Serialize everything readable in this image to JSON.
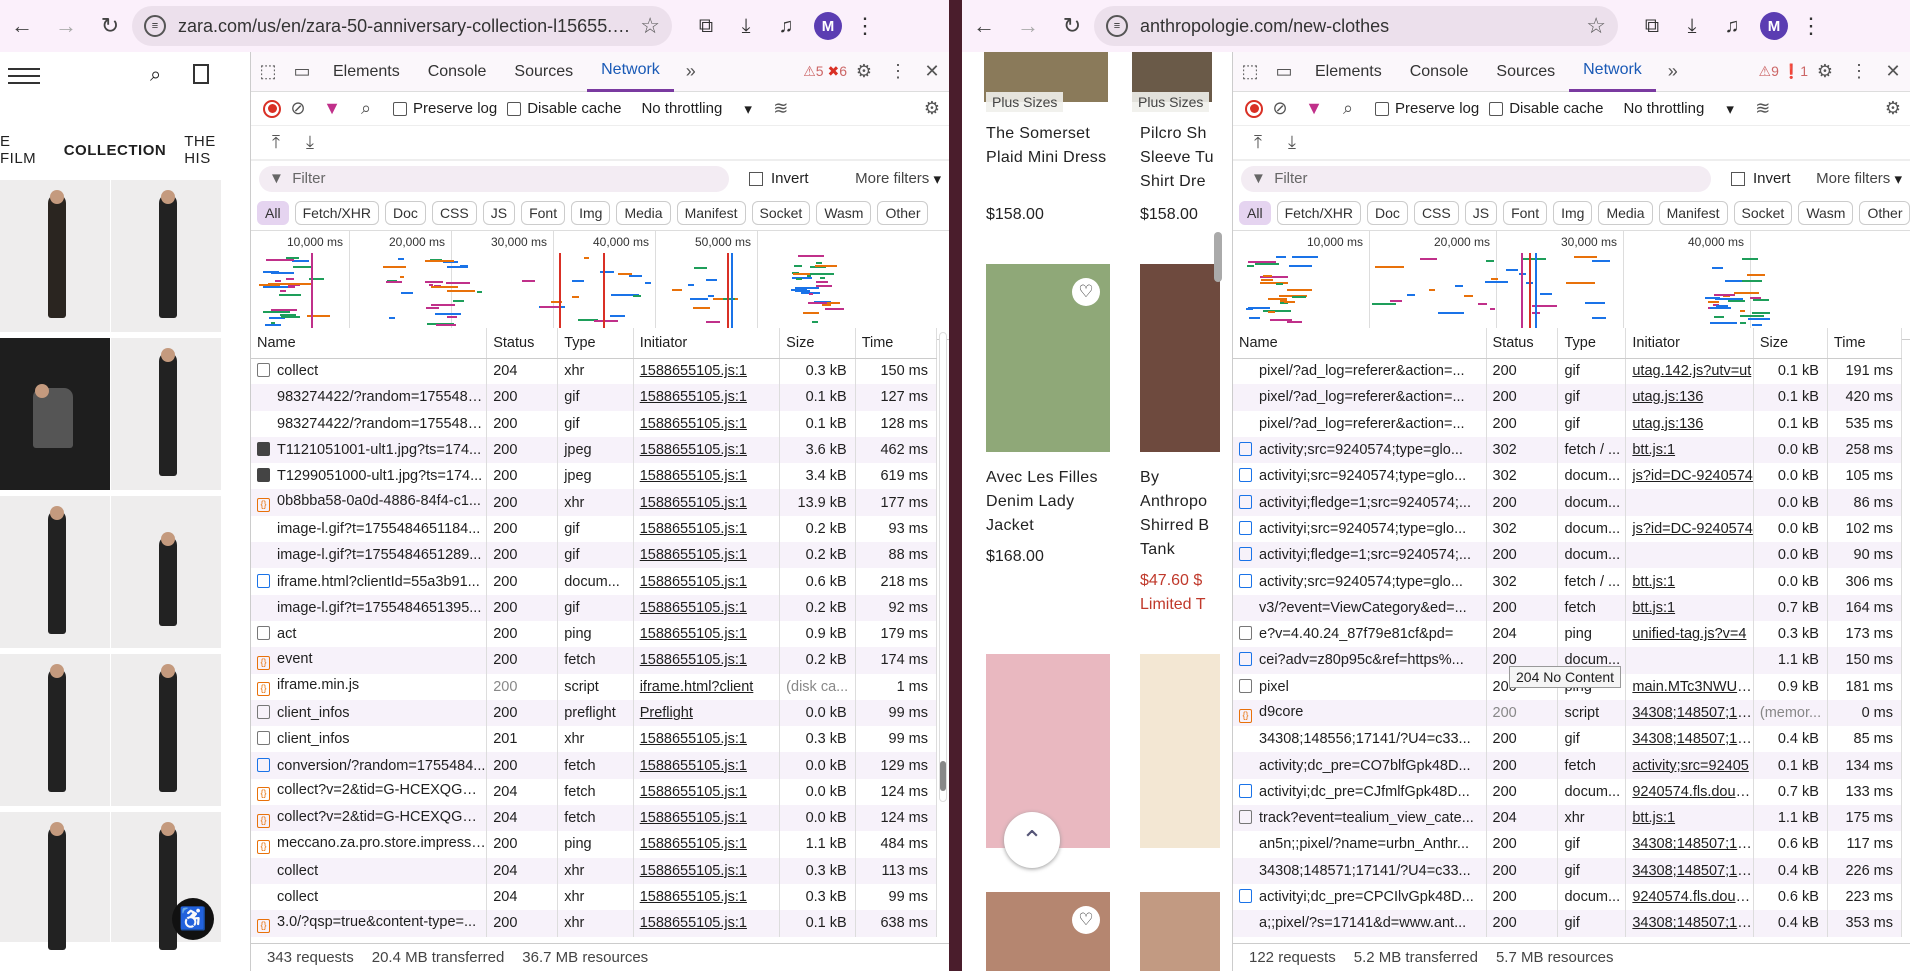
{
  "left": {
    "url": "zara.com/us/en/zara-50-anniversary-collection-l15655.h...",
    "avatar": "M",
    "site_tabs": [
      "E FILM",
      "COLLECTION",
      "THE HIS"
    ],
    "devtools": {
      "tabs": [
        "Elements",
        "Console",
        "Sources",
        "Network"
      ],
      "warnings": "5",
      "errors": "6",
      "preserve_log": "Preserve log",
      "disable_cache": "Disable cache",
      "throttling": "No throttling",
      "filter_placeholder": "Filter",
      "invert": "Invert",
      "more_filters": "More filters",
      "chips": [
        "All",
        "Fetch/XHR",
        "Doc",
        "CSS",
        "JS",
        "Font",
        "Img",
        "Media",
        "Manifest",
        "Socket",
        "Wasm",
        "Other"
      ],
      "ticks": [
        "10,000 ms",
        "20,000 ms",
        "30,000 ms",
        "40,000 ms",
        "50,000 ms"
      ],
      "columns": [
        "Name",
        "Status",
        "Type",
        "Initiator",
        "Size",
        "Time"
      ],
      "rows": [
        {
          "icon": "none",
          "name": "collect",
          "status": "204",
          "type": "xhr",
          "initiator": "1588655105.js:1",
          "size": "0.3 kB",
          "time": "150 ms"
        },
        {
          "icon": "blank",
          "name": "983274422/?random=1755484...",
          "status": "200",
          "type": "gif",
          "initiator": "1588655105.js:1",
          "size": "0.1 kB",
          "time": "127 ms"
        },
        {
          "icon": "blank",
          "name": "983274422/?random=1755484...",
          "status": "200",
          "type": "gif",
          "initiator": "1588655105.js:1",
          "size": "0.1 kB",
          "time": "128 ms"
        },
        {
          "icon": "img",
          "name": "T1121051001-ult1.jpg?ts=174...",
          "status": "200",
          "type": "jpeg",
          "initiator": "1588655105.js:1",
          "size": "3.6 kB",
          "time": "462 ms"
        },
        {
          "icon": "img",
          "name": "T1299051000-ult1.jpg?ts=174...",
          "status": "200",
          "type": "jpeg",
          "initiator": "1588655105.js:1",
          "size": "3.4 kB",
          "time": "619 ms"
        },
        {
          "icon": "script",
          "name": "0b8bba58-0a0d-4886-84f4-c1...",
          "status": "200",
          "type": "xhr",
          "initiator": "1588655105.js:1",
          "size": "13.9 kB",
          "time": "177 ms"
        },
        {
          "icon": "blank",
          "name": "image-l.gif?t=1755484651184...",
          "status": "200",
          "type": "gif",
          "initiator": "1588655105.js:1",
          "size": "0.2 kB",
          "time": "93 ms"
        },
        {
          "icon": "blank",
          "name": "image-l.gif?t=1755484651289...",
          "status": "200",
          "type": "gif",
          "initiator": "1588655105.js:1",
          "size": "0.2 kB",
          "time": "88 ms"
        },
        {
          "icon": "doc",
          "name": "iframe.html?clientId=55a3b91...",
          "status": "200",
          "type": "docum...",
          "initiator": "1588655105.js:1",
          "size": "0.6 kB",
          "time": "218 ms"
        },
        {
          "icon": "blank",
          "name": "image-l.gif?t=1755484651395...",
          "status": "200",
          "type": "gif",
          "initiator": "1588655105.js:1",
          "size": "0.2 kB",
          "time": "92 ms"
        },
        {
          "icon": "none",
          "name": "act",
          "status": "200",
          "type": "ping",
          "initiator": "1588655105.js:1",
          "size": "0.9 kB",
          "time": "179 ms"
        },
        {
          "icon": "script",
          "name": "event",
          "status": "200",
          "type": "fetch",
          "initiator": "1588655105.js:1",
          "size": "0.2 kB",
          "time": "174 ms"
        },
        {
          "icon": "script",
          "name": "iframe.min.js",
          "status": "200",
          "type": "script",
          "initiator": "iframe.html?client",
          "size": "(disk ca...",
          "time": "1 ms"
        },
        {
          "icon": "none",
          "name": "client_infos",
          "status": "200",
          "type": "preflight",
          "initiator": "Preflight",
          "size": "0.0 kB",
          "time": "99 ms"
        },
        {
          "icon": "none",
          "name": "client_infos",
          "status": "201",
          "type": "xhr",
          "initiator": "1588655105.js:1",
          "size": "0.3 kB",
          "time": "99 ms"
        },
        {
          "icon": "doc",
          "name": "conversion/?random=1755484...",
          "status": "200",
          "type": "fetch",
          "initiator": "1588655105.js:1",
          "size": "0.0 kB",
          "time": "129 ms"
        },
        {
          "icon": "script",
          "name": "collect?v=2&tid=G-HCEXQGE0...",
          "status": "204",
          "type": "fetch",
          "initiator": "1588655105.js:1",
          "size": "0.0 kB",
          "time": "124 ms"
        },
        {
          "icon": "script",
          "name": "collect?v=2&tid=G-HCEXQGE0...",
          "status": "204",
          "type": "fetch",
          "initiator": "1588655105.js:1",
          "size": "0.0 kB",
          "time": "124 ms"
        },
        {
          "icon": "script",
          "name": "meccano.za.pro.store.impressi...",
          "status": "200",
          "type": "ping",
          "initiator": "1588655105.js:1",
          "size": "1.1 kB",
          "time": "484 ms"
        },
        {
          "icon": "blank",
          "name": "collect",
          "status": "204",
          "type": "xhr",
          "initiator": "1588655105.js:1",
          "size": "0.3 kB",
          "time": "113 ms"
        },
        {
          "icon": "blank",
          "name": "collect",
          "status": "204",
          "type": "xhr",
          "initiator": "1588655105.js:1",
          "size": "0.3 kB",
          "time": "99 ms"
        },
        {
          "icon": "script",
          "name": "3.0/?qsp=true&content-type=...",
          "status": "200",
          "type": "xhr",
          "initiator": "1588655105.js:1",
          "size": "0.1 kB",
          "time": "638 ms"
        }
      ],
      "requests": "343 requests",
      "transferred": "20.4 MB transferred",
      "resources": "36.7 MB resources"
    }
  },
  "right": {
    "url": "anthropologie.com/new-clothes",
    "avatar": "M",
    "products": [
      {
        "tag": "Plus Sizes",
        "title": "The Somerset Plaid Mini Dress",
        "price": "$158.00"
      },
      {
        "tag": "Plus Sizes",
        "title": "Pilcro Sh Sleeve Tu Shirt Dre",
        "price": "$158.00"
      },
      {
        "title": "Avec Les Filles Denim Lady Jacket",
        "price": "$168.00"
      },
      {
        "title": "By Anthropo Shirred B Tank",
        "price": "$47.60 $",
        "sale": "Limited T"
      }
    ],
    "devtools": {
      "tabs": [
        "Elements",
        "Console",
        "Sources",
        "Network"
      ],
      "warnings": "9",
      "errors": "1",
      "preserve_log": "Preserve log",
      "disable_cache": "Disable cache",
      "throttling": "No throttling",
      "filter_placeholder": "Filter",
      "invert": "Invert",
      "more_filters": "More filters",
      "chips": [
        "All",
        "Fetch/XHR",
        "Doc",
        "CSS",
        "JS",
        "Font",
        "Img",
        "Media",
        "Manifest",
        "Socket",
        "Wasm",
        "Other"
      ],
      "ticks": [
        "10,000 ms",
        "20,000 ms",
        "30,000 ms",
        "40,000 ms"
      ],
      "columns": [
        "Name",
        "Status",
        "Type",
        "Initiator",
        "Size",
        "Time"
      ],
      "rows": [
        {
          "icon": "blank",
          "name": "pixel/?ad_log=referer&action=...",
          "status": "200",
          "type": "gif",
          "initiator": "utag.142.js?utv=ut",
          "size": "0.1 kB",
          "time": "191 ms"
        },
        {
          "icon": "blank",
          "name": "pixel/?ad_log=referer&action=...",
          "status": "200",
          "type": "gif",
          "initiator": "utag.js:136",
          "size": "0.1 kB",
          "time": "420 ms"
        },
        {
          "icon": "blank",
          "name": "pixel/?ad_log=referer&action=...",
          "status": "200",
          "type": "gif",
          "initiator": "utag.js:136",
          "size": "0.1 kB",
          "time": "535 ms"
        },
        {
          "icon": "doc",
          "name": "activity;src=9240574;type=glo...",
          "status": "302",
          "type": "fetch / ...",
          "initiator": "btt.js:1",
          "size": "0.0 kB",
          "time": "258 ms"
        },
        {
          "icon": "doc",
          "name": "activityi;src=9240574;type=glo...",
          "status": "302",
          "type": "docum...",
          "initiator": "js?id=DC-9240574",
          "size": "0.0 kB",
          "time": "105 ms"
        },
        {
          "icon": "doc",
          "name": "activityi;fledge=1;src=9240574;...",
          "status": "200",
          "type": "docum...",
          "initiator": "",
          "size": "0.0 kB",
          "time": "86 ms"
        },
        {
          "icon": "doc",
          "name": "activityi;src=9240574;type=glo...",
          "status": "302",
          "type": "docum...",
          "initiator": "js?id=DC-9240574",
          "size": "0.0 kB",
          "time": "102 ms"
        },
        {
          "icon": "doc",
          "name": "activityi;fledge=1;src=9240574;...",
          "status": "200",
          "type": "docum...",
          "initiator": "",
          "size": "0.0 kB",
          "time": "90 ms"
        },
        {
          "icon": "doc",
          "name": "activity;src=9240574;type=glo...",
          "status": "302",
          "type": "fetch / ...",
          "initiator": "btt.js:1",
          "size": "0.0 kB",
          "time": "306 ms"
        },
        {
          "icon": "blank",
          "name": "v3/?event=ViewCategory&ed=...",
          "status": "200",
          "type": "fetch",
          "initiator": "btt.js:1",
          "size": "0.7 kB",
          "time": "164 ms"
        },
        {
          "icon": "none",
          "name": "e?v=4.40.24_87f79e81cf&pd=",
          "status": "204",
          "type": "ping",
          "initiator": "unified-tag.js?v=4",
          "size": "0.3 kB",
          "time": "173 ms"
        },
        {
          "icon": "doc",
          "name": "cei?adv=z80p95c&ref=https%...",
          "status": "200",
          "type": "docum...",
          "initiator": "",
          "size": "1.1 kB",
          "time": "150 ms"
        },
        {
          "icon": "none",
          "name": "pixel",
          "status": "200",
          "type": "ping",
          "initiator": "main.MTc3NWUxZ",
          "size": "0.9 kB",
          "time": "181 ms"
        },
        {
          "icon": "script",
          "name": "d9core",
          "status": "200",
          "type": "script",
          "initiator": "34308;148507;171",
          "size": "(memor...",
          "time": "0 ms"
        },
        {
          "icon": "blank",
          "name": "34308;148556;17141/?U4=c33...",
          "status": "200",
          "type": "gif",
          "initiator": "34308;148507;171",
          "size": "0.4 kB",
          "time": "85 ms"
        },
        {
          "icon": "blank",
          "name": "activity;dc_pre=CO7blfGpk48D...",
          "status": "200",
          "type": "fetch",
          "initiator": "activity;src=92405",
          "size": "0.1 kB",
          "time": "134 ms"
        },
        {
          "icon": "doc",
          "name": "activityi;dc_pre=CJfmlfGpk48D...",
          "status": "200",
          "type": "docum...",
          "initiator": "9240574.fls.double",
          "size": "0.7 kB",
          "time": "133 ms"
        },
        {
          "icon": "none",
          "name": "track?event=tealium_view_cate...",
          "status": "204",
          "type": "xhr",
          "initiator": "btt.js:1",
          "size": "1.1 kB",
          "time": "175 ms"
        },
        {
          "icon": "blank",
          "name": "an5n;;pixel/?name=urbn_Anthr...",
          "status": "200",
          "type": "gif",
          "initiator": "34308;148507;171",
          "size": "0.6 kB",
          "time": "117 ms"
        },
        {
          "icon": "blank",
          "name": "34308;148571;17141/?U4=c33...",
          "status": "200",
          "type": "gif",
          "initiator": "34308;148507;171",
          "size": "0.4 kB",
          "time": "226 ms"
        },
        {
          "icon": "doc",
          "name": "activityi;dc_pre=CPCIlvGpk48D...",
          "status": "200",
          "type": "docum...",
          "initiator": "9240574.fls.double",
          "size": "0.6 kB",
          "time": "223 ms"
        },
        {
          "icon": "blank",
          "name": "a;;pixel/?s=17141&d=www.ant...",
          "status": "200",
          "type": "gif",
          "initiator": "34308;148507;171",
          "size": "0.4 kB",
          "time": "353 ms"
        }
      ],
      "tooltip": "204 No Content",
      "requests": "122 requests",
      "transferred": "5.2 MB transferred",
      "resources": "5.7 MB resources"
    }
  }
}
